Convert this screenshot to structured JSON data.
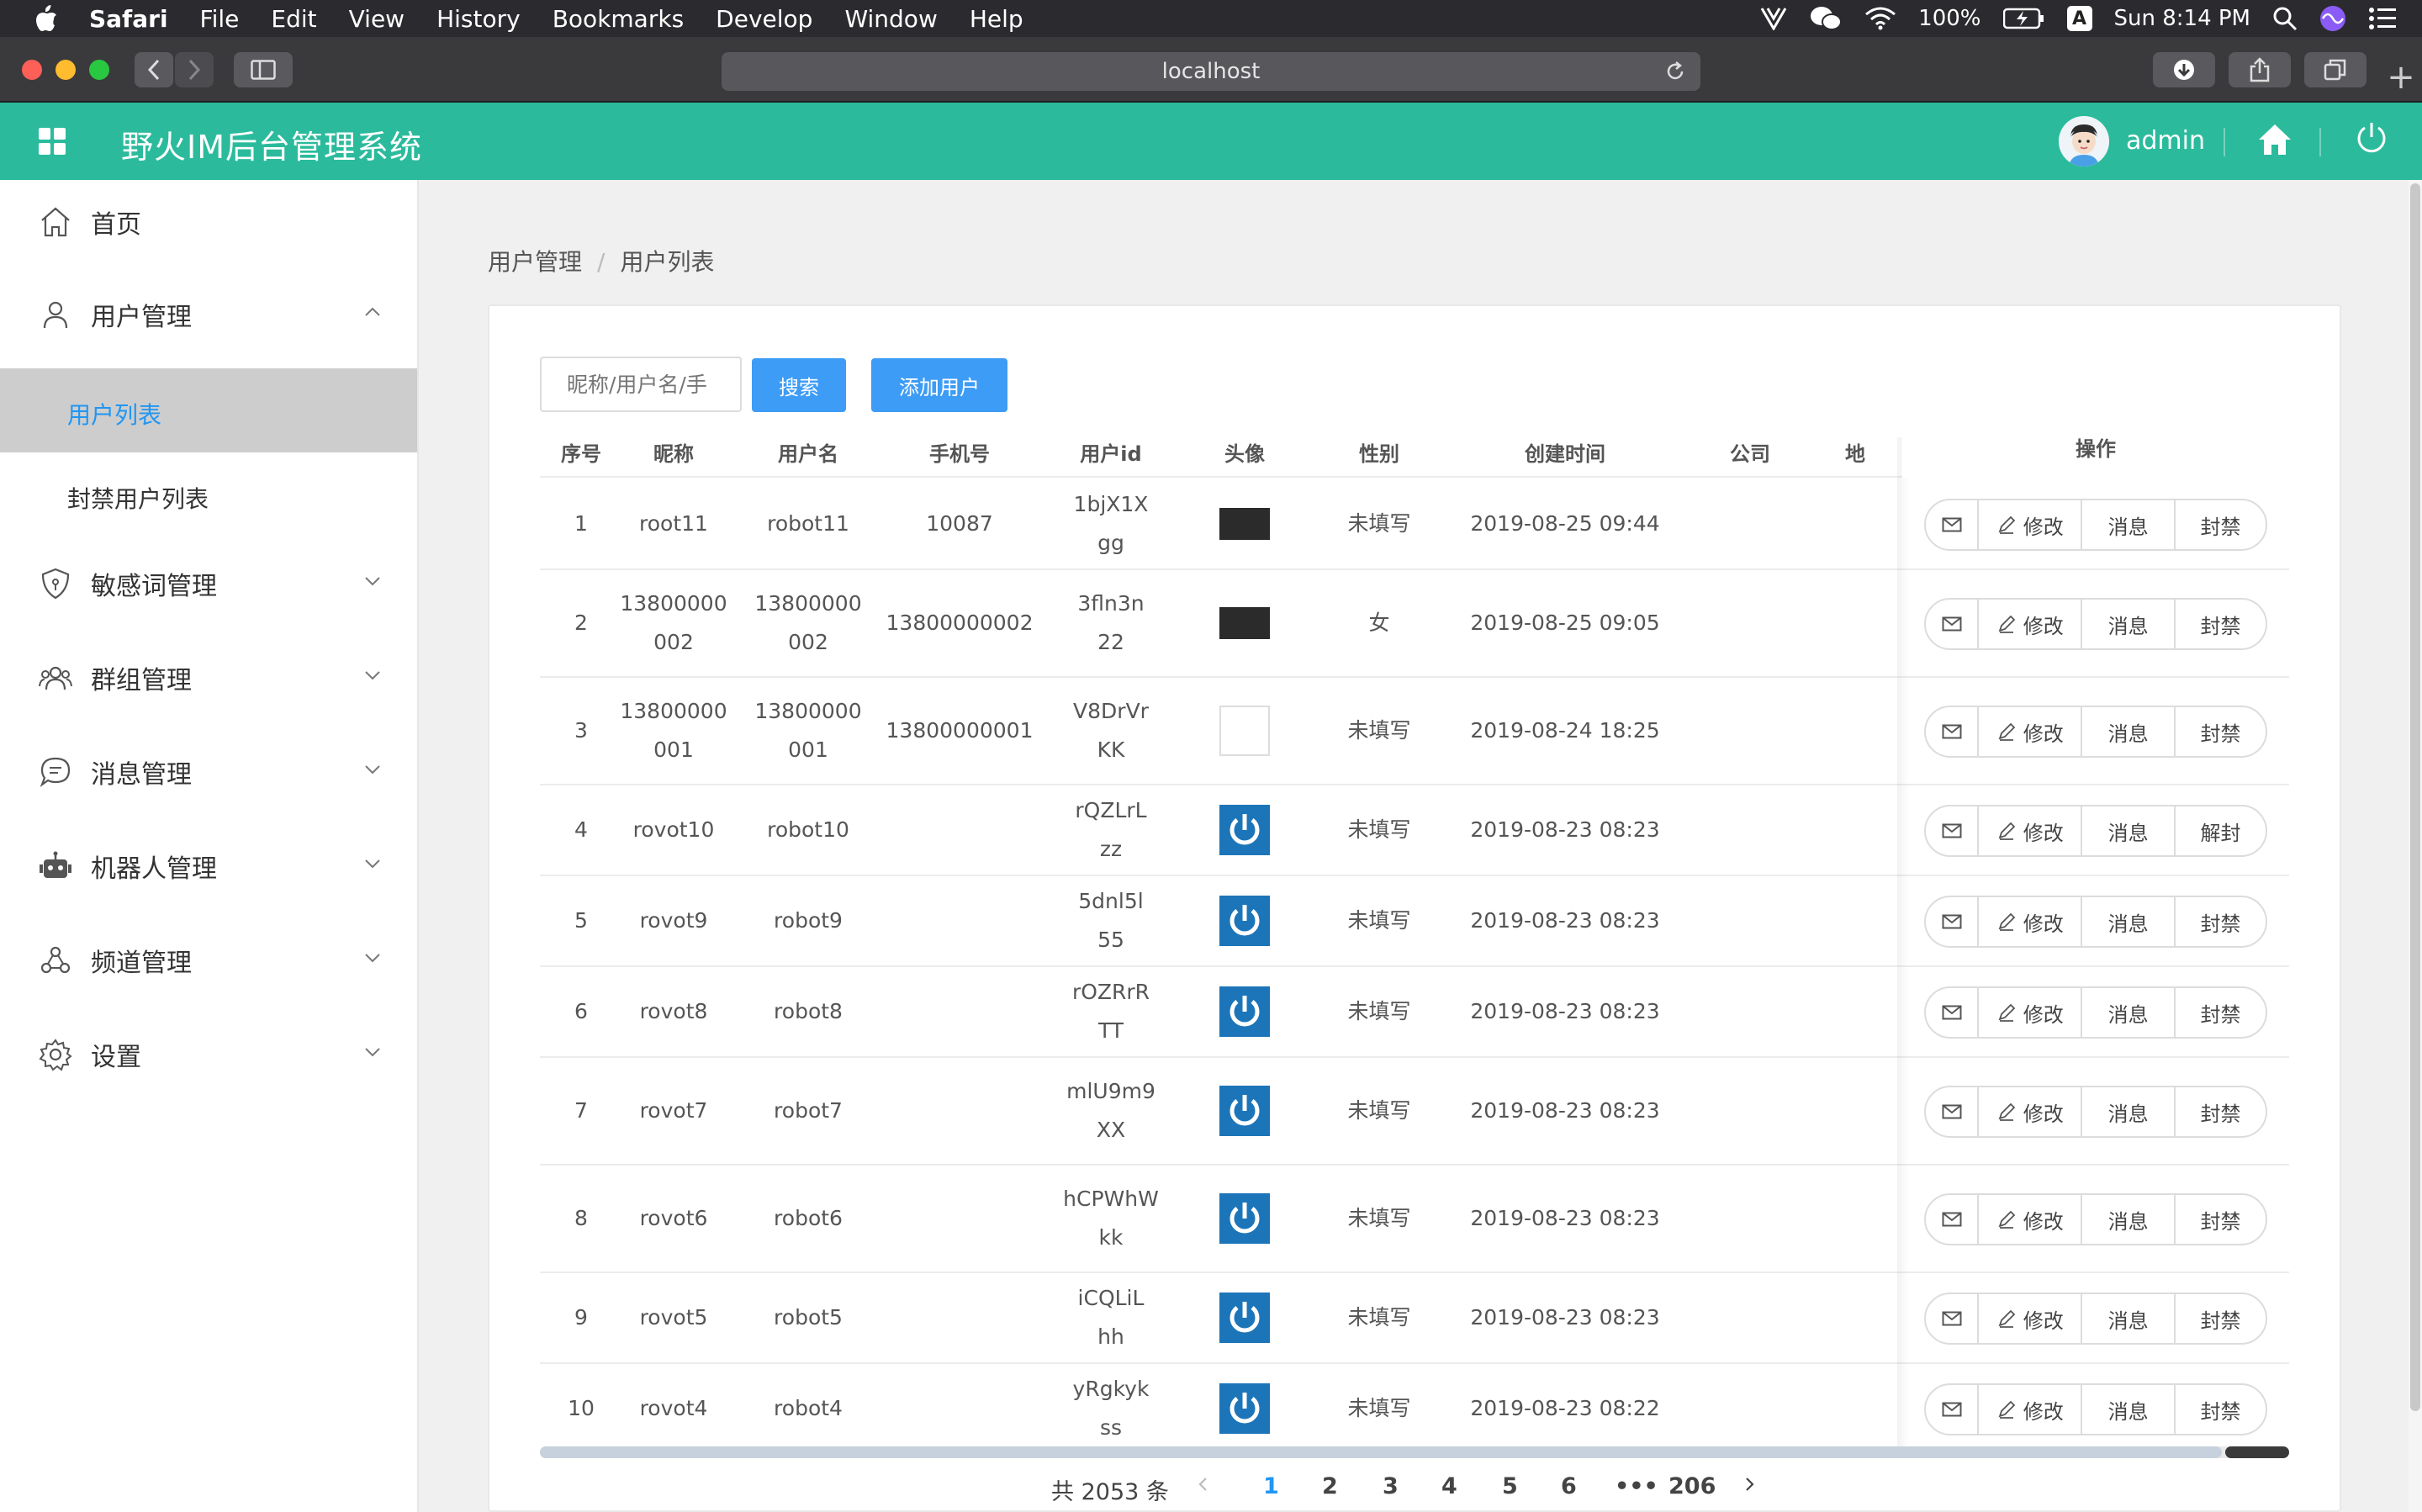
{
  "menubar": {
    "app_name": "Safari",
    "items": [
      "File",
      "Edit",
      "View",
      "History",
      "Bookmarks",
      "Develop",
      "Window",
      "Help"
    ],
    "battery": "100%",
    "input_source": "A",
    "clock": "Sun 8:14 PM"
  },
  "browser": {
    "url": "localhost"
  },
  "header": {
    "title": "野火IM后台管理系统",
    "user": "admin",
    "accent": "#2bbb9c"
  },
  "sidebar": {
    "home": "首页",
    "user_mgmt": "用户管理",
    "user_list": "用户列表",
    "banned_list": "封禁用户列表",
    "sensitive": "敏感词管理",
    "group": "群组管理",
    "message": "消息管理",
    "robot": "机器人管理",
    "channel": "频道管理",
    "settings": "设置"
  },
  "breadcrumb": {
    "parent": "用户管理",
    "separator": "/",
    "current": "用户列表"
  },
  "toolbar": {
    "search_placeholder": "昵称/用户名/手",
    "search_label": "搜索",
    "add_label": "添加用户"
  },
  "table": {
    "columns": [
      "序号",
      "昵称",
      "用户名",
      "手机号",
      "用户id",
      "头像",
      "性别",
      "创建时间",
      "公司",
      "地",
      "操作"
    ],
    "rows": [
      {
        "idx": "1",
        "nick": "root11",
        "uname": "robot11",
        "phone": "10087",
        "uid": "1bjX1Xgg",
        "avatar": "dark",
        "gender": "未填写",
        "created": "2019-08-25 09:44",
        "ban": "封禁"
      },
      {
        "idx": "2",
        "nick": "13800000002",
        "uname": "13800000002",
        "phone": "13800000002",
        "uid": "3fln3n22",
        "avatar": "dark",
        "gender": "女",
        "created": "2019-08-25 09:05",
        "ban": "封禁"
      },
      {
        "idx": "3",
        "nick": "13800000001",
        "uname": "13800000001",
        "phone": "13800000001",
        "uid": "V8DrVrKK",
        "avatar": "white",
        "gender": "未填写",
        "created": "2019-08-24 18:25",
        "ban": "封禁"
      },
      {
        "idx": "4",
        "nick": "rovot10",
        "uname": "robot10",
        "phone": "",
        "uid": "rQZLrLzz",
        "avatar": "blue",
        "gender": "未填写",
        "created": "2019-08-23 08:23",
        "ban": "解封"
      },
      {
        "idx": "5",
        "nick": "rovot9",
        "uname": "robot9",
        "phone": "",
        "uid": "5dnl5l55",
        "avatar": "blue",
        "gender": "未填写",
        "created": "2019-08-23 08:23",
        "ban": "封禁"
      },
      {
        "idx": "6",
        "nick": "rovot8",
        "uname": "robot8",
        "phone": "",
        "uid": "rOZRrRTT",
        "avatar": "blue",
        "gender": "未填写",
        "created": "2019-08-23 08:23",
        "ban": "封禁"
      },
      {
        "idx": "7",
        "nick": "rovot7",
        "uname": "robot7",
        "phone": "",
        "uid": "mlU9m9XX",
        "avatar": "blue",
        "gender": "未填写",
        "created": "2019-08-23 08:23",
        "ban": "封禁"
      },
      {
        "idx": "8",
        "nick": "rovot6",
        "uname": "robot6",
        "phone": "",
        "uid": "hCPWhWkk",
        "avatar": "blue",
        "gender": "未填写",
        "created": "2019-08-23 08:23",
        "ban": "封禁"
      },
      {
        "idx": "9",
        "nick": "rovot5",
        "uname": "robot5",
        "phone": "",
        "uid": "iCQLiLhh",
        "avatar": "blue",
        "gender": "未填写",
        "created": "2019-08-23 08:23",
        "ban": "封禁"
      },
      {
        "idx": "10",
        "nick": "rovot4",
        "uname": "robot4",
        "phone": "",
        "uid": "yRgkykss",
        "avatar": "blue",
        "gender": "未填写",
        "created": "2019-08-23 08:22",
        "ban": "封禁"
      }
    ],
    "actions": {
      "edit": "修改",
      "message": "消息"
    }
  },
  "pagination": {
    "total": "共 2053 条",
    "pages": [
      "1",
      "2",
      "3",
      "4",
      "5",
      "6"
    ],
    "ellipsis": "•••",
    "last": "206",
    "current": "1"
  },
  "colors": {
    "primary_button": "#3d9cf5",
    "active_link": "#2196f3",
    "avatar_blue": "#1d75b9"
  }
}
